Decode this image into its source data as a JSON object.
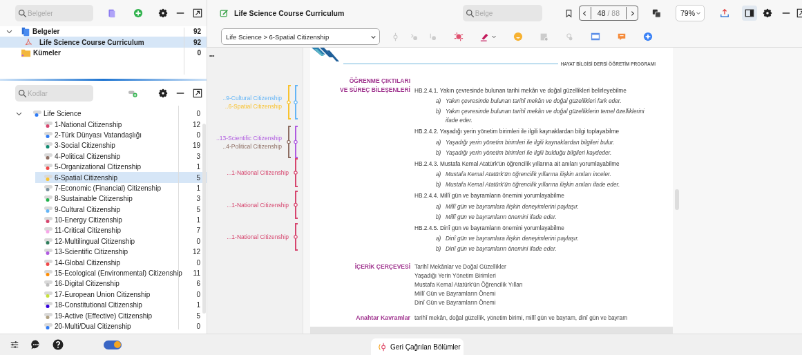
{
  "docs_panel": {
    "search_placeholder": "Belgeler",
    "tree": [
      {
        "label": "Belgeler",
        "count": "92",
        "kind": "docs",
        "expanded": true,
        "selected": false,
        "children": [
          {
            "label": "Life Science Course Curriculum",
            "count": "92",
            "kind": "pdf",
            "selected": true
          }
        ]
      },
      {
        "label": "Kümeler",
        "count": "0",
        "kind": "sets",
        "selected": false
      }
    ]
  },
  "codes_panel": {
    "search_placeholder": "Kodlar",
    "root": {
      "label": "Life Science",
      "count": "0",
      "expanded": true,
      "color": "#2f7bf5",
      "children": [
        {
          "label": "1-National Citizenship",
          "count": "12",
          "color": "#d6456e",
          "selected": false
        },
        {
          "label": "2-Türk Dünyası Vatandaşlığı",
          "count": "0",
          "color": "#2f7bf5",
          "selected": false
        },
        {
          "label": "3-Social  Citizenship",
          "count": "19",
          "color": "#0f8a70",
          "selected": false
        },
        {
          "label": "4-Political Citizenship",
          "count": "3",
          "color": "#8d6e63",
          "selected": false
        },
        {
          "label": "5-Organizational Citizenship",
          "count": "1",
          "color": "#f04848",
          "selected": false
        },
        {
          "label": "6-Spatial Citizenship",
          "count": "5",
          "color": "#f9c22e",
          "selected": true
        },
        {
          "label": "7-Economic (Financial) Citizenship",
          "count": "1",
          "color": "#78909c",
          "selected": false
        },
        {
          "label": "8-Sustainable Citizenship",
          "count": "3",
          "color": "#22b14c",
          "selected": false
        },
        {
          "label": "9-Cultural Citizenship",
          "count": "5",
          "color": "#64b5f6",
          "selected": false
        },
        {
          "label": "10-Energy Citizenship",
          "count": "1",
          "color": "#d6456e",
          "selected": false
        },
        {
          "label": "11-Critical Citizenship",
          "count": "7",
          "color": "#f7a6e8",
          "selected": false
        },
        {
          "label": "12-Multilingual Citizenship",
          "count": "0",
          "color": "#2e7d5b",
          "selected": false
        },
        {
          "label": "13-Scientific Citizenship",
          "count": "12",
          "color": "#b05be0",
          "selected": false
        },
        {
          "label": "14-Global Citizenship",
          "count": "0",
          "color": "#f04848",
          "selected": false
        },
        {
          "label": "15-Ecological (Environmental) Citizenship",
          "count": "11",
          "color": "#ff8c00",
          "selected": false
        },
        {
          "label": "16-Digital Citizenship",
          "count": "6",
          "color": "#bdbdbd",
          "selected": false
        },
        {
          "label": "17-European Union Citizenship",
          "count": "0",
          "color": "#c6e03a",
          "selected": false
        },
        {
          "label": "18-Constitutional Citizenship",
          "count": "1",
          "color": "#3300dd",
          "selected": false
        },
        {
          "label": "19-Active (Effective) Citizenship",
          "count": "5",
          "color": "#b0a080",
          "selected": false
        },
        {
          "label": "20-Multi/Dual Citizenship",
          "count": "0",
          "color": "#2f7bf5",
          "selected": false
        }
      ]
    }
  },
  "document": {
    "title": "Life Science Course Curriculum",
    "search_placeholder": "Belge",
    "page_current": "48",
    "page_total": "/ 88",
    "zoom": "79%",
    "code_selector": "Life Science > 6-Spatial Citizenship",
    "margin_more": "•••",
    "annotation_groups": [
      {
        "items": [
          {
            "label": "..9-Cultural Citizenship",
            "color": "#64b5f6"
          },
          {
            "label": "..6-Spatial Citizenship",
            "color": "#f9c22e"
          }
        ]
      },
      {
        "items": [
          {
            "label": "..13-Scientific Citizenship",
            "color": "#b05be0"
          },
          {
            "label": "..4-Political Citizenship",
            "color": "#8d6e63"
          }
        ]
      },
      {
        "items": [
          {
            "label": "...1-National Citizenship",
            "color": "#d6456e"
          }
        ]
      },
      {
        "items": [
          {
            "label": "...1-National Citizenship",
            "color": "#d6456e"
          }
        ]
      },
      {
        "items": [
          {
            "label": "...1-National Citizenship",
            "color": "#d6456e"
          }
        ]
      }
    ],
    "page": {
      "header": "HAYAT BİLGİSİ DERSİ ÖĞRETİM PROGRAMI",
      "outcomes_label": [
        "ÖĞRENME ÇIKTILARI",
        "VE SÜREÇ BİLEŞENLERİ"
      ],
      "outcomes": [
        {
          "code": "HB.2.4.1.",
          "text": "Yakın çevresinde bulunan tarihi mekân ve doğal güzellikleri belirleyebilme",
          "subs": [
            {
              "letter": "a)",
              "text": "Yakın çevresinde bulunan tarihî mekân ve doğal güzellikleri fark eder."
            },
            {
              "letter": "b)",
              "text": "Yakın çevresinde bulunan tarihî mekân ve doğal güzelliklerin temel özelliklerini ifade eder."
            }
          ]
        },
        {
          "code": "HB.2.4.2.",
          "text": "Yaşadığı yerin yönetim birimleri ile ilgili kaynaklardan bilgi toplayabilme",
          "subs": [
            {
              "letter": "a)",
              "text": "Yaşadığı yerin yönetim birimleri ile ilgili kaynaklardan bilgileri bulur."
            },
            {
              "letter": "b)",
              "text": "Yaşadığı yerin yönetim birimleri ile ilgili bulduğu bilgileri kaydeder."
            }
          ]
        },
        {
          "code": "HB.2.4.3.",
          "text": "Mustafa Kemal Atatürk'ün öğrencilik yıllarına ait anıları yorumlayabilme",
          "subs": [
            {
              "letter": "a)",
              "text": "Mustafa Kemal Atatürk'ün öğrencilik yıllarına ilişkin anıları inceler."
            },
            {
              "letter": "b)",
              "text": "Mustafa Kemal Atatürk'ün öğrencilik yıllarına ilişkin anıları ifade eder."
            }
          ]
        },
        {
          "code": "HB.2.4.4.",
          "text": "Millî gün ve bayramların önemini yorumlayabilme",
          "subs": [
            {
              "letter": "a)",
              "text": "Millî gün ve bayramlara ilişkin deneyimlerini paylaşır."
            },
            {
              "letter": "b)",
              "text": "Millî gün ve bayramların önemini ifade eder."
            }
          ]
        },
        {
          "code": "HB.2.4.5.",
          "text": "Dinî gün ve bayramların önemini yorumlayabilme",
          "subs": [
            {
              "letter": "a)",
              "text": "Dinî gün ve bayramlara ilişkin deneyimlerini paylaşır."
            },
            {
              "letter": "b)",
              "text": "Dinî gün ve bayramların önemini ifade eder."
            }
          ]
        }
      ],
      "content_label": "İÇERİK ÇERÇEVESİ",
      "content_lines": [
        "Tarihî Mekânlar ve Doğal Güzellikler",
        "Yaşadığı Yerin Yönetim Birimleri",
        "Mustafa Kemal Atatürk'ün Öğrencilik Yılları",
        "Millî Gün ve Bayramların Önemi",
        "Dinî Gün ve Bayramların Önemi"
      ],
      "keywords_label": "Anahtar Kavramlar",
      "keywords": "tarihî mekân, doğal güzellik, yönetim birimi, millî gün ve bayram, dinî gün ve bayram"
    }
  },
  "bottom_bar": {
    "toggle_on": true,
    "recalled_button": "Geri Çağrılan Bölümler"
  }
}
